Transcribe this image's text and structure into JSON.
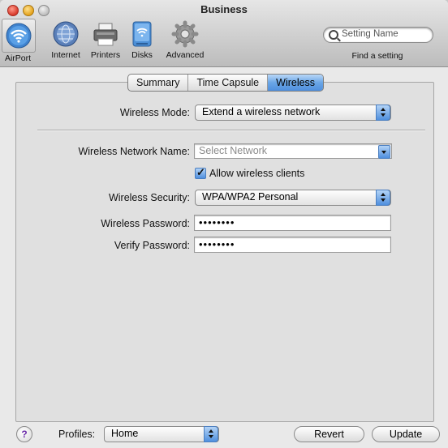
{
  "window": {
    "title": "Business"
  },
  "toolbar": {
    "items": [
      {
        "label": "AirPort",
        "icon": "airport-icon"
      },
      {
        "label": "Internet",
        "icon": "internet-globe-icon"
      },
      {
        "label": "Printers",
        "icon": "printer-icon"
      },
      {
        "label": "Disks",
        "icon": "disk-icon"
      },
      {
        "label": "Advanced",
        "icon": "gear-icon"
      }
    ],
    "search": {
      "placeholder": "Setting Name",
      "caption": "Find a setting"
    }
  },
  "tabs": [
    {
      "label": "Summary",
      "active": false
    },
    {
      "label": "Time Capsule",
      "active": false
    },
    {
      "label": "Wireless",
      "active": true
    }
  ],
  "form": {
    "wireless_mode": {
      "label": "Wireless Mode:",
      "value": "Extend a wireless network"
    },
    "network_name": {
      "label": "Wireless Network Name:",
      "placeholder": "Select Network"
    },
    "allow_clients": {
      "label": "Allow wireless clients",
      "checked": true
    },
    "security": {
      "label": "Wireless Security:",
      "value": "WPA/WPA2 Personal"
    },
    "password": {
      "label": "Wireless Password:",
      "value": "••••••••"
    },
    "verify": {
      "label": "Verify Password:",
      "value": "••••••••"
    }
  },
  "footer": {
    "help": "?",
    "profiles_label": "Profiles:",
    "profile_value": "Home",
    "revert_label": "Revert",
    "update_label": "Update"
  },
  "colors": {
    "accent": "#4f8fde",
    "close": "#d8392a",
    "minimize": "#e4a21c"
  }
}
